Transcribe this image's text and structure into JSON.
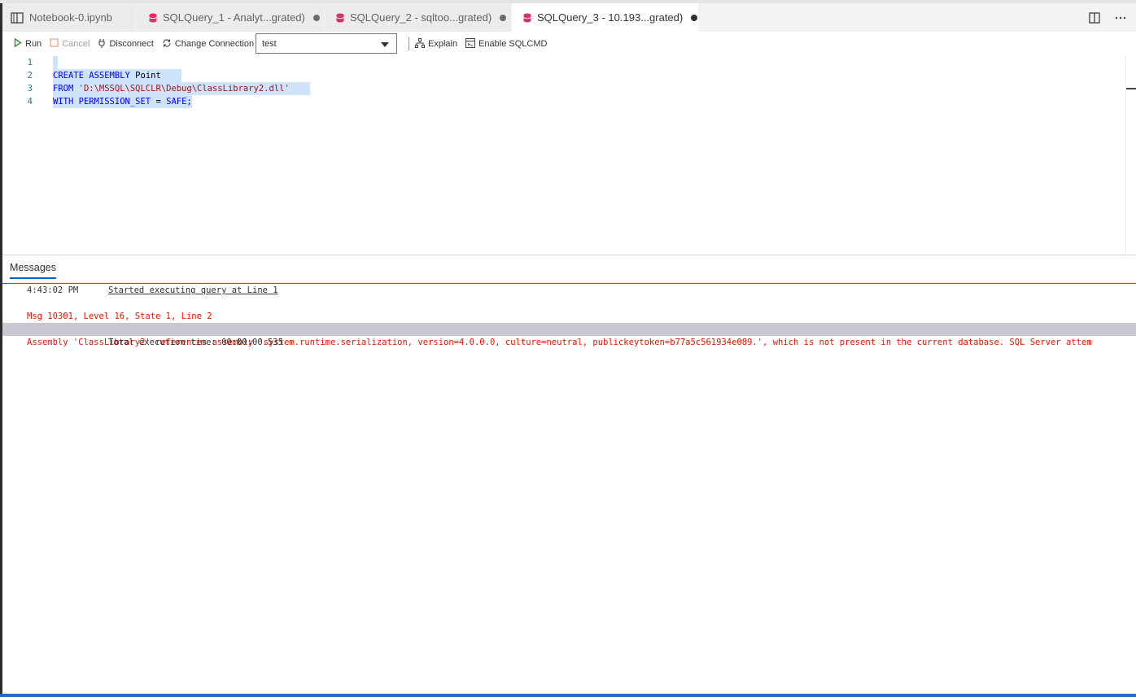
{
  "tabs": [
    {
      "label": "Notebook-0.ipynb",
      "icon": "notebook-icon",
      "dirty": false,
      "active": false
    },
    {
      "label": "SQLQuery_1 - Analyt...grated)",
      "icon": "database-icon",
      "dirty": true,
      "active": false
    },
    {
      "label": "SQLQuery_2 - sqltoo...grated)",
      "icon": "database-icon",
      "dirty": true,
      "active": false
    },
    {
      "label": "SQLQuery_3 - 10.193...grated)",
      "icon": "database-icon",
      "dirty": true,
      "active": true
    }
  ],
  "toolbar": {
    "run_label": "Run",
    "cancel_label": "Cancel",
    "disconnect_label": "Disconnect",
    "change_connection_label": "Change Connection",
    "database_value": "test",
    "explain_label": "Explain",
    "sqlcmd_label": "Enable SQLCMD"
  },
  "editor": {
    "line_numbers": [
      "1",
      "2",
      "3",
      "4"
    ],
    "line2": {
      "kw1": "CREATE",
      "kw2": "ASSEMBLY",
      "ident": "Point"
    },
    "line3": {
      "kw": "FROM",
      "str": "'D:\\MSSQL\\SQLCLR\\Debug\\ClassLibrary2.dll'"
    },
    "line4": {
      "kw": "WITH",
      "ident": "PERMISSION_SET",
      "eq": "=",
      "val": "SAFE;"
    }
  },
  "results": {
    "tab_label": "Messages",
    "time": "4:43:02 PM",
    "started": "Started executing query at Line 1",
    "msg_header": "Msg 10301, Level 16, State 1, Line 2",
    "msg_body": "Assembly 'ClassLibrary2' references assembly 'system.runtime.serialization, version=4.0.0.0, culture=neutral, publickeytoken=b77a5c561934e089.', which is not present in the current database. SQL Server attem",
    "exec_time": "Total execution time: 00:00:00.535"
  },
  "colors": {
    "error": "#e51400",
    "keyword": "#0000ff",
    "string": "#a31515",
    "accent": "#005fb8",
    "db_icon": "#d6336c"
  }
}
